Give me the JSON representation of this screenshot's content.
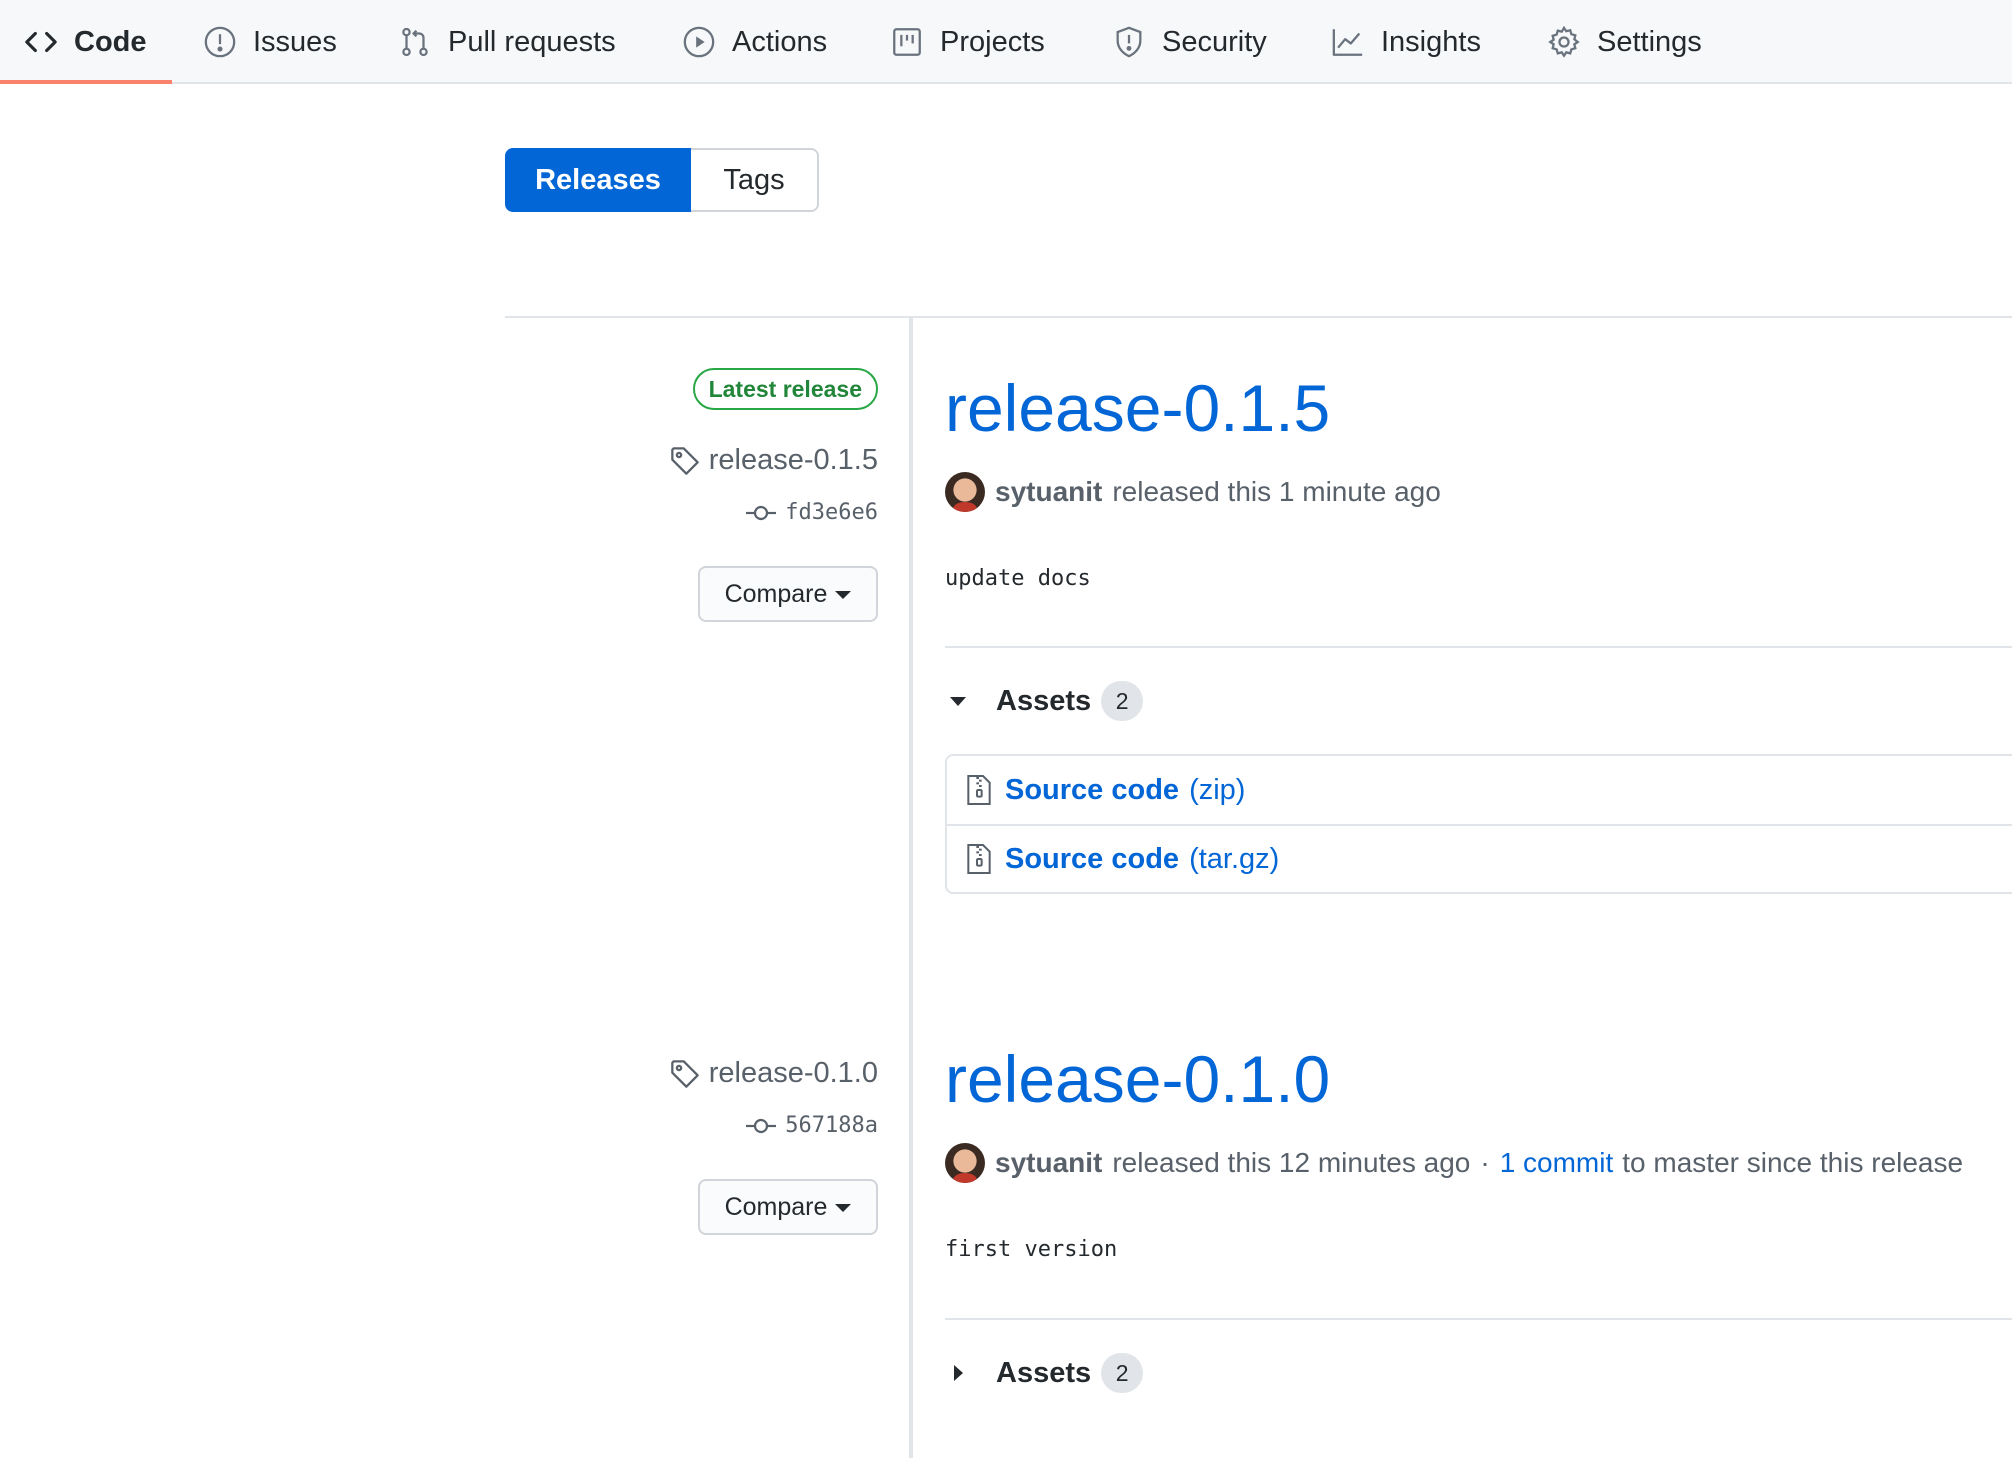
{
  "nav": {
    "items": [
      {
        "label": "Code",
        "icon": "code-icon",
        "active": true
      },
      {
        "label": "Issues",
        "icon": "issue-icon"
      },
      {
        "label": "Pull requests",
        "icon": "pull-request-icon"
      },
      {
        "label": "Actions",
        "icon": "play-icon"
      },
      {
        "label": "Projects",
        "icon": "project-icon"
      },
      {
        "label": "Security",
        "icon": "shield-icon"
      },
      {
        "label": "Insights",
        "icon": "graph-icon"
      },
      {
        "label": "Settings",
        "icon": "gear-icon"
      }
    ],
    "active_underline_color": "#f9826c"
  },
  "segmented": {
    "releases": "Releases",
    "tags": "Tags",
    "active": "Releases"
  },
  "releases": [
    {
      "badge": "Latest release",
      "tag": "release-0.1.5",
      "commit": "fd3e6e6",
      "compare": "Compare",
      "title": "release-0.1.5",
      "author": "sytuanit",
      "released_text": "released this 1 minute ago",
      "notes": "update docs",
      "assets_label": "Assets",
      "assets_count": "2",
      "assets_expanded": true,
      "assets": [
        {
          "name": "Source code",
          "ext": "(zip)",
          "icon": "file-zip-icon"
        },
        {
          "name": "Source code",
          "ext": "(tar.gz)",
          "icon": "file-zip-icon"
        }
      ]
    },
    {
      "tag": "release-0.1.0",
      "commit": "567188a",
      "compare": "Compare",
      "title": "release-0.1.0",
      "author": "sytuanit",
      "released_text": "released this 12 minutes ago",
      "separator": "·",
      "commits_link": "1 commit",
      "commits_suffix": "to master since this release",
      "notes": "first version",
      "assets_label": "Assets",
      "assets_count": "2",
      "assets_expanded": false
    }
  ],
  "colors": {
    "link": "#0366d6",
    "badge_green": "#22863a",
    "primary_button": "#0366d6"
  }
}
